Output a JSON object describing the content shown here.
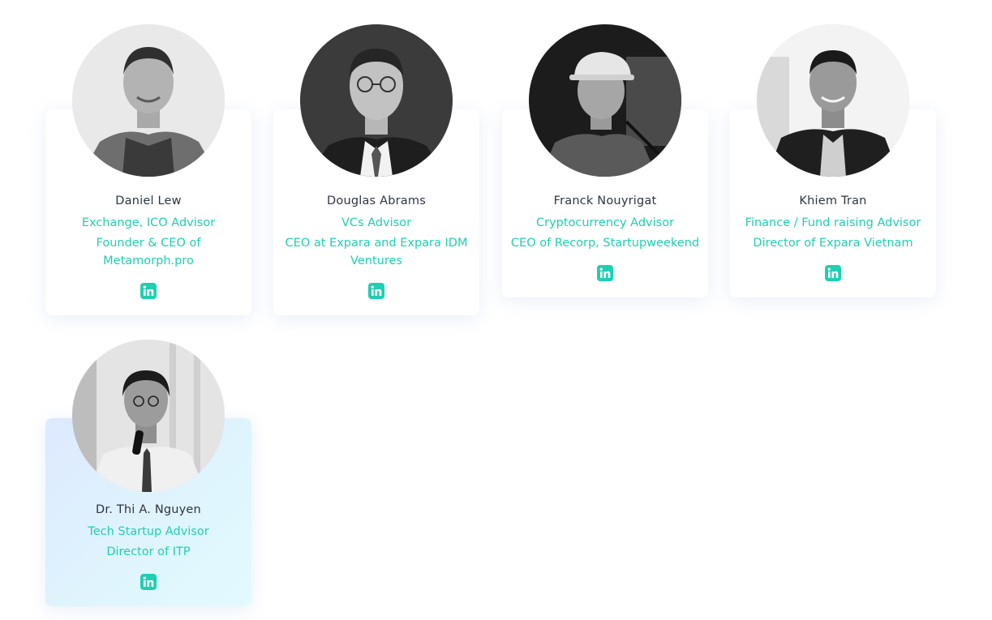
{
  "accent_color": "#1fcfb1",
  "advisors": [
    {
      "name": "Daniel Lew",
      "role": "Exchange, ICO Advisor",
      "position": "Founder & CEO of Metamorph.pro",
      "social_icon": "linkedin-icon"
    },
    {
      "name": "Douglas Abrams",
      "role": "VCs Advisor",
      "position": "CEO at Expara and Expara IDM Ventures",
      "social_icon": "linkedin-icon"
    },
    {
      "name": "Franck Nouyrigat",
      "role": "Cryptocurrency Advisor",
      "position": "CEO of Recorp, Startupweekend",
      "social_icon": "linkedin-icon"
    },
    {
      "name": "Khiem Tran",
      "role": "Finance / Fund raising Advisor",
      "position": "Director of Expara Vietnam",
      "social_icon": "linkedin-icon"
    },
    {
      "name": "Dr. Thi A. Nguyen",
      "role": "Tech Startup Advisor",
      "position": "Director of ITP",
      "social_icon": "linkedin-icon"
    }
  ]
}
